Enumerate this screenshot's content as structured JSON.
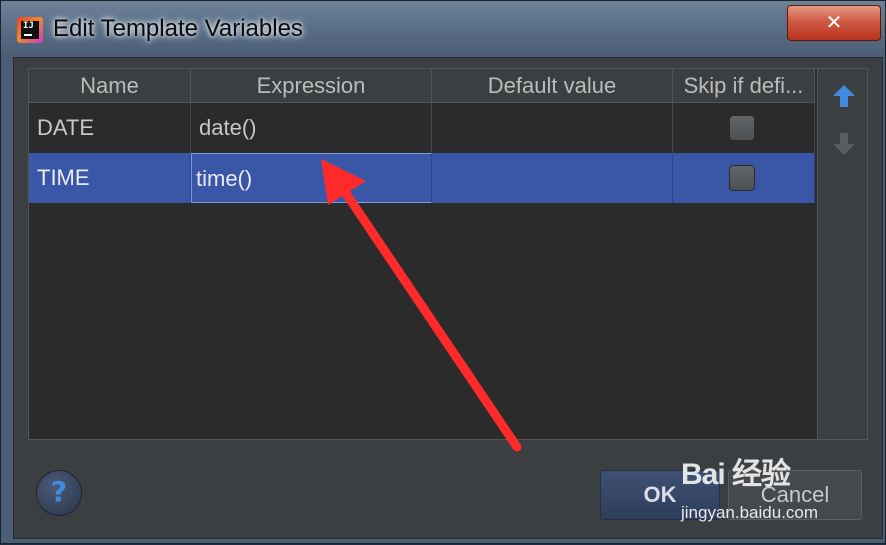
{
  "window": {
    "title": "Edit Template Variables",
    "close_symbol": "✕"
  },
  "table": {
    "columns": [
      "Name",
      "Expression",
      "Default value",
      "Skip if defi..."
    ],
    "rows": [
      {
        "name": "DATE",
        "expression": "date()",
        "default_value": "",
        "skip_if_defined": false,
        "selected": false
      },
      {
        "name": "TIME",
        "expression": "time()",
        "default_value": "",
        "skip_if_defined": false,
        "selected": true
      }
    ]
  },
  "toolbar": {
    "move_up_icon": "arrow-up-icon",
    "move_down_icon": "arrow-down-icon"
  },
  "buttons": {
    "help": "?",
    "ok": "OK",
    "cancel": "Cancel"
  },
  "watermark": {
    "main": "Bai 经验",
    "sub": "jingyan.baidu.com"
  },
  "colors": {
    "selection": "#3a56a6",
    "annotation_arrow": "#ff2a2a",
    "accent_blue": "#3f8be0"
  }
}
